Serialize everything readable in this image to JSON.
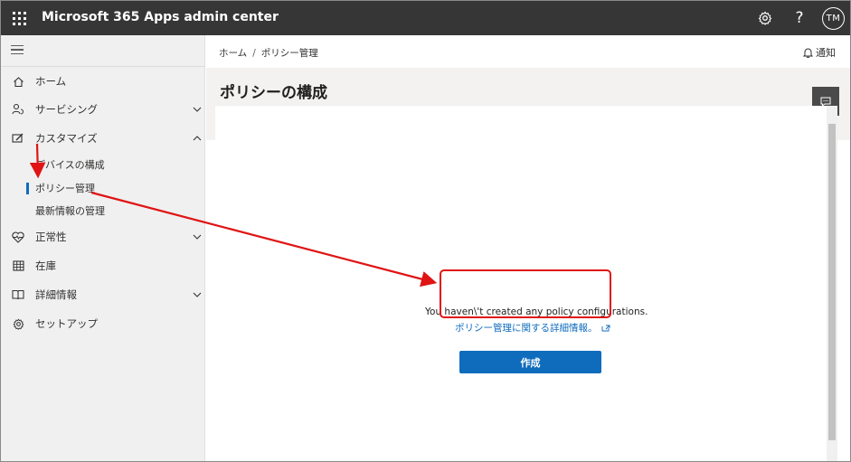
{
  "topbar": {
    "app_title": "Microsoft 365 Apps admin center",
    "icons": [
      "waffle-icon",
      "gear-icon",
      "help-icon"
    ],
    "avatar_initials": "TM"
  },
  "sidebar": {
    "items": [
      {
        "label": "ホーム",
        "icon": "home-icon",
        "chevron": null
      },
      {
        "label": "サービシング",
        "icon": "person-sync-icon",
        "chevron": "down"
      },
      {
        "label": "カスタマイズ",
        "icon": "edit-board-icon",
        "chevron": "up"
      },
      {
        "label": "正常性",
        "icon": "heart-pulse-icon",
        "chevron": "down"
      },
      {
        "label": "在庫",
        "icon": "grid-icon",
        "chevron": null
      },
      {
        "label": "詳細情報",
        "icon": "book-icon",
        "chevron": "down"
      },
      {
        "label": "セットアップ",
        "icon": "settings-icon",
        "chevron": null
      }
    ],
    "sub_items": [
      {
        "label": "デバイスの構成",
        "selected": false
      },
      {
        "label": "ポリシー管理",
        "selected": true
      },
      {
        "label": "最新情報の管理",
        "selected": false
      }
    ]
  },
  "breadcrumb": {
    "items": [
      "ホーム",
      "ポリシー管理"
    ],
    "separator": "/"
  },
  "notify_label": "通知",
  "page_title": "ポリシーの構成",
  "empty_state": {
    "message": "You haven\\'t created any policy configurations.",
    "link": "ポリシー管理に関する詳細情報。"
  },
  "create_button": "作成",
  "colors": {
    "accent": "#0f6cbd",
    "topbar": "#363636",
    "annotation": "#e01414"
  }
}
